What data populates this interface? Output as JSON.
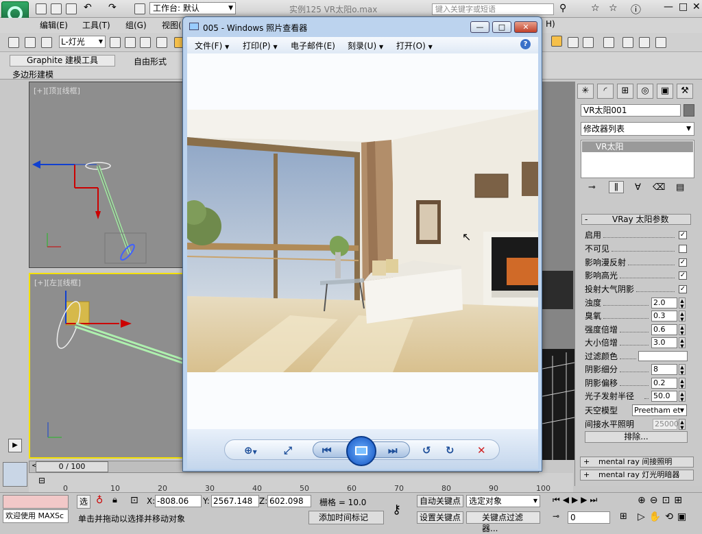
{
  "app": {
    "workspace_label": "工作台: 默认",
    "file_title": "实例125    VR太阳o.max",
    "search_placeholder": "键入关键字或短语"
  },
  "menu": {
    "items": [
      "编辑(E)",
      "工具(T)",
      "组(G)",
      "视图("
    ],
    "trailing": "H)"
  },
  "toolbar": {
    "selection_filter": "L-灯光"
  },
  "ribbon": {
    "tabs": [
      "Graphite 建模工具",
      "自由形式"
    ],
    "sub_label": "多边形建模"
  },
  "viewports": {
    "top_label": "[+][顶][线框]",
    "left_label": "[+][左][线框]"
  },
  "command_panel": {
    "object_name": "VR太阳001",
    "object_color": "#777777",
    "modifier_list": "修改器列表",
    "stack_item": "VR太阳",
    "rollout_title": "VRay 太阳参数",
    "rollout_toggle": "-",
    "checks": [
      {
        "label": "启用",
        "checked": true,
        "mark": "✓"
      },
      {
        "label": "不可见",
        "checked": false,
        "mark": ""
      },
      {
        "label": "影响漫反射",
        "checked": true,
        "mark": "✓"
      },
      {
        "label": "影响高光",
        "checked": true,
        "mark": "✓"
      },
      {
        "label": "投射大气阴影",
        "checked": true,
        "mark": "✓"
      }
    ],
    "spinners_a": [
      {
        "label": "浊度",
        "value": "2.0"
      },
      {
        "label": "臭氧",
        "value": "0.3"
      },
      {
        "label": "强度倍增",
        "value": "0.6"
      },
      {
        "label": "大小倍增",
        "value": "3.0"
      }
    ],
    "filter_color_label": "过滤颜色",
    "filter_color": "#ffffff",
    "spinners_b": [
      {
        "label": "阴影细分",
        "value": "8"
      },
      {
        "label": "阴影偏移",
        "value": "0.2"
      },
      {
        "label": "光子发射半径",
        "value": "50.0"
      }
    ],
    "sky_model_label": "天空模型",
    "sky_model_value": "Preetham et",
    "horiz_label": "间接水平照明",
    "horiz_value": "25000.",
    "exclude_label": "排除...",
    "extra_rollouts": [
      {
        "toggle": "+",
        "label": "mental ray 间接照明"
      },
      {
        "toggle": "+",
        "label": "mental ray 灯光明暗器"
      }
    ]
  },
  "timeline": {
    "frame_display": "0 / 100",
    "ticks": [
      "0",
      "10",
      "20",
      "30",
      "40",
      "50",
      "60",
      "70",
      "80",
      "90",
      "100"
    ]
  },
  "status": {
    "maxscript_label": "欢迎使用 MAXSc",
    "selection_lock_label": "选",
    "x_label": "X:",
    "x_value": "-808.06",
    "y_label": "Y:",
    "y_value": "2567.148",
    "z_label": "Z:",
    "z_value": "602.098",
    "grid_label": "栅格 = 10.0",
    "status_text": "单击并拖动以选择并移动对象",
    "add_time_tag": "添加时间标记",
    "auto_key": "自动关键点",
    "set_key": "设置关键点",
    "selected_set": "选定对象",
    "key_filters": "关键点过滤器...",
    "current_frame": "0"
  },
  "photo_viewer": {
    "title": "005 - Windows 照片查看器",
    "menu": [
      "文件(F)",
      "打印(P)",
      "电子邮件(E)",
      "刻录(U)",
      "打开(O)"
    ],
    "help_glyph": "?",
    "min_glyph": "—",
    "max_glyph": "□",
    "close_glyph": "✕",
    "controls": {
      "zoom": "⊕",
      "fit": "⤢",
      "prev": "⏮",
      "next": "⏭",
      "rotate_ccw": "↺",
      "rotate_cw": "↻",
      "delete": "✕"
    }
  }
}
